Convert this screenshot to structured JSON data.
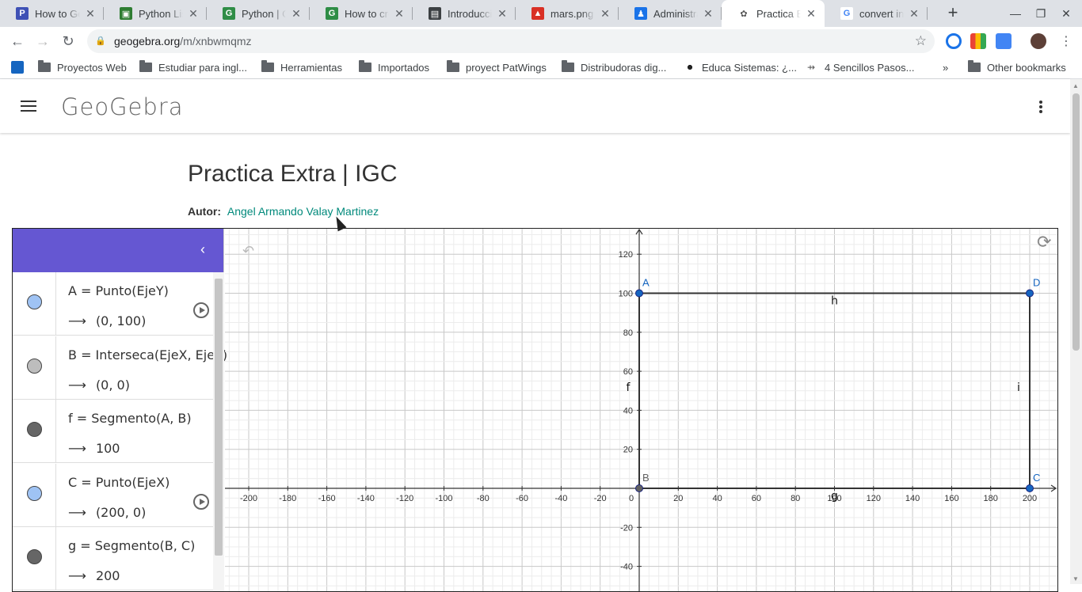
{
  "browser": {
    "tabs": [
      {
        "title": "How to Get",
        "favicon": "geeks-icon",
        "fav_color": "#3f51b5",
        "fav_text": "P"
      },
      {
        "title": "Python List",
        "favicon": "android-icon",
        "fav_color": "#2e7d32",
        "fav_text": "▣"
      },
      {
        "title": "Python | G",
        "favicon": "gfg-icon",
        "fav_color": "#2f8d46",
        "fav_text": "G"
      },
      {
        "title": "How to cre",
        "favicon": "gfg-icon",
        "fav_color": "#2f8d46",
        "fav_text": "G"
      },
      {
        "title": "Introducci",
        "favicon": "contact-card-icon",
        "fav_color": "#3c4043",
        "fav_text": "▤"
      },
      {
        "title": "mars.png -",
        "favicon": "image-icon",
        "fav_color": "#d93025",
        "fav_text": "▲"
      },
      {
        "title": "Administra",
        "favicon": "admin-icon",
        "fav_color": "#1a73e8",
        "fav_text": "♟"
      },
      {
        "title": "Practica Ex",
        "favicon": "geogebra-icon",
        "fav_color": "#ffffff",
        "fav_text": "✿",
        "active": true
      },
      {
        "title": "convert int",
        "favicon": "google-icon",
        "fav_color": "#ffffff",
        "fav_text": "G"
      }
    ],
    "url_host": "geogebra.org",
    "url_path": "/m/xnbwmqmz",
    "bookmarks": [
      {
        "label": "Proyectos Web"
      },
      {
        "label": "Estudiar para ingl..."
      },
      {
        "label": "Herramientas"
      },
      {
        "label": "Importados"
      },
      {
        "label": "proyect PatWings"
      },
      {
        "label": "Distribudoras dig..."
      },
      {
        "label": "Educa Sistemas: ¿..."
      },
      {
        "label": "4 Sencillos Pasos..."
      }
    ],
    "other_bookmarks": "Other bookmarks",
    "more": "»"
  },
  "header": {
    "logo": "GeoGebra"
  },
  "page": {
    "title": "Practica Extra | IGC",
    "author_label": "Autor:",
    "author_name": "Angel Armando Valay Martinez"
  },
  "algebra": {
    "items": [
      {
        "def": "A = Punto(EjeY)",
        "val": "(0,  100)",
        "marble": "#9fc3f4",
        "play": true
      },
      {
        "def": "B = Interseca(EjeX, EjeY)",
        "val": "(0,  0)",
        "marble": "#bdbdbd",
        "play": false
      },
      {
        "def": "f = Segmento(A, B)",
        "val": "100",
        "marble": "#666666",
        "play": false
      },
      {
        "def": "C = Punto(EjeX)",
        "val": "(200,  0)",
        "marble": "#9fc3f4",
        "play": true
      },
      {
        "def": "g = Segmento(B, C)",
        "val": "200",
        "marble": "#666666",
        "play": false
      }
    ],
    "arrow": "⟶"
  },
  "graph": {
    "x_ticks": [
      -200,
      -180,
      -160,
      -140,
      -120,
      -100,
      -80,
      -60,
      -40,
      -20,
      0,
      20,
      40,
      60,
      80,
      100,
      120,
      140,
      160,
      180,
      200
    ],
    "y_ticks": [
      120,
      100,
      80,
      60,
      40,
      20,
      -20,
      -40
    ],
    "points": [
      {
        "name": "A",
        "x": 0,
        "y": 100,
        "color": "#1565c0"
      },
      {
        "name": "B",
        "x": 0,
        "y": 0,
        "color": "#616161"
      },
      {
        "name": "C",
        "x": 200,
        "y": 0,
        "color": "#1565c0"
      },
      {
        "name": "D",
        "x": 200,
        "y": 100,
        "color": "#1565c0"
      }
    ],
    "segments": [
      {
        "name": "f",
        "from": "A",
        "to": "B"
      },
      {
        "name": "g",
        "from": "B",
        "to": "C"
      },
      {
        "name": "h",
        "from": "A",
        "to": "D"
      },
      {
        "name": "i",
        "from": "D",
        "to": "C"
      }
    ]
  }
}
